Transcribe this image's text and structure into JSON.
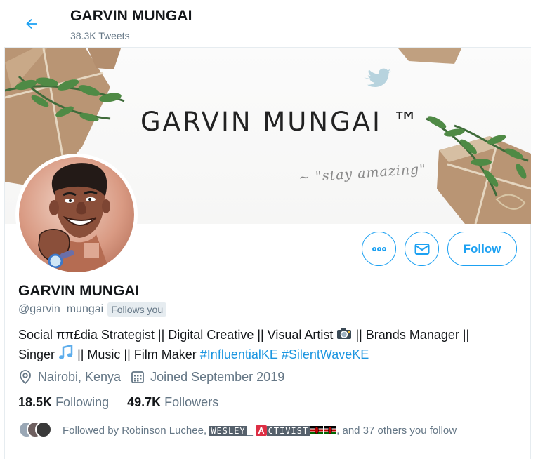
{
  "header": {
    "name": "GARVIN MUNGAI",
    "tweet_count": "38.3K Tweets"
  },
  "banner": {
    "title": "GARVIN MUNGAI ™",
    "tagline": "~ \"stay amazing\""
  },
  "actions": {
    "follow_label": "Follow",
    "more_icon": "ellipsis-icon",
    "message_icon": "envelope-icon"
  },
  "profile": {
    "name": "GARVIN MUNGAI",
    "handle": "@garvin_mungai",
    "follows_you": "Follows you",
    "bio_line1": "Social ππ£dia Strategist || Digital Creative || Visual Artist",
    "bio_line1b": "|| Brands Manager ||",
    "bio_line2a": "Singer",
    "bio_line2b": "|| Music || Film Maker",
    "hashtag1": "#InfluentialKE",
    "hashtag2": "#SilentWaveKE",
    "location": "Nairobi, Kenya",
    "joined": "Joined September 2019"
  },
  "stats": {
    "following_count": "18.5K",
    "following_label": "Following",
    "followers_count": "49.7K",
    "followers_label": "Followers"
  },
  "followed_by": {
    "prefix": "Followed by Robinson Luchee,",
    "name2_box": "WESLEY",
    "name2_tail": "_",
    "name3_letter": "A",
    "name3_box": "CTIVIST",
    "suffix": ", and 37 others you follow"
  },
  "colors": {
    "accent": "#1da1f2",
    "link": "#1b95e0",
    "muted": "#657786"
  }
}
